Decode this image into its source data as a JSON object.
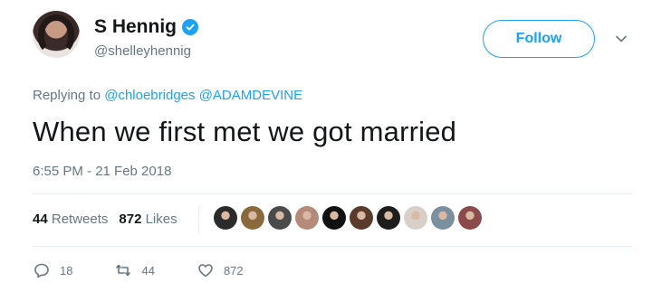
{
  "user": {
    "name": "S Hennig",
    "handle": "@shelleyhennig"
  },
  "follow_label": "Follow",
  "replying": {
    "prefix": "Replying to",
    "mentions": [
      "@chloebridges",
      "@ADAMDEVINE"
    ]
  },
  "tweet_text": "When we first met we got married",
  "timestamp": "6:55 PM - 21 Feb 2018",
  "stats": {
    "retweets_count": "44",
    "retweets_label": "Retweets",
    "likes_count": "872",
    "likes_label": "Likes"
  },
  "likers": [
    {
      "icon": "liker-avatar",
      "color": "#2b2b2b"
    },
    {
      "icon": "liker-avatar",
      "color": "#8a6a3c"
    },
    {
      "icon": "liker-avatar",
      "color": "#4a4a4a"
    },
    {
      "icon": "liker-avatar",
      "color": "#b48a7a"
    },
    {
      "icon": "liker-avatar",
      "color": "#111111"
    },
    {
      "icon": "liker-avatar",
      "color": "#5a3a2a"
    },
    {
      "icon": "liker-avatar",
      "color": "#1d1d1d"
    },
    {
      "icon": "liker-avatar",
      "color": "#d8cfc8"
    },
    {
      "icon": "liker-avatar",
      "color": "#7a8fa0"
    },
    {
      "icon": "liker-avatar",
      "color": "#8c4a4a"
    }
  ],
  "actions": {
    "reply_count": "18",
    "retweet_count": "44",
    "like_count": "872"
  },
  "colors": {
    "accent": "#1da1f2",
    "text": "#14171a",
    "muted": "#657786"
  }
}
